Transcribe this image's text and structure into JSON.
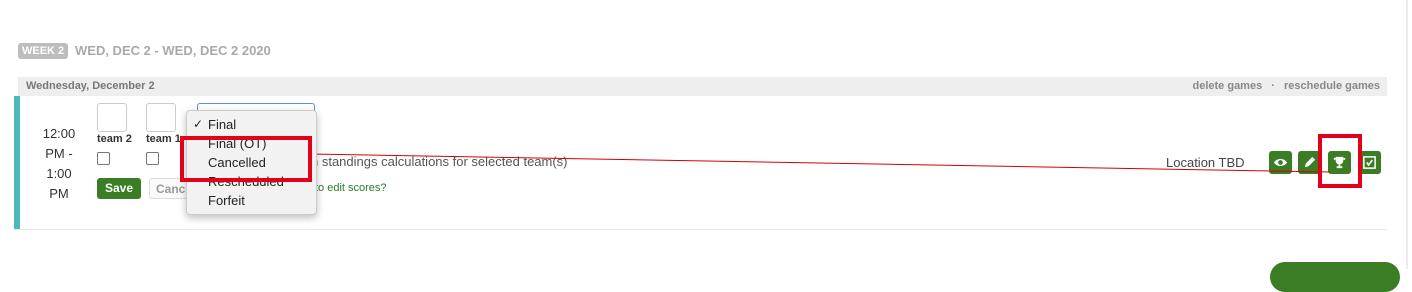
{
  "week": {
    "badge": "WEEK 2",
    "range": "WED, DEC 2 - WED, DEC 2 2020"
  },
  "day": {
    "title": "Wednesday, December 2",
    "actions": [
      "delete games",
      "·",
      "reschedule games"
    ]
  },
  "game": {
    "time_lines": [
      "12:00",
      "PM -",
      "1:00",
      "PM"
    ],
    "teams": [
      {
        "label": "team 2"
      },
      {
        "label": "team 1"
      }
    ],
    "standings_text": "n standings calculations for selected team(s)",
    "edit_link": "to edit scores?",
    "save_label": "Save",
    "cancel_label": "Cancel",
    "location": "Location TBD",
    "status_options": [
      "Final",
      "Final (OT)",
      "Cancelled",
      "Rescheduled",
      "Forfeit"
    ],
    "status_selected": "Final"
  },
  "icons": {
    "view": "eye-icon",
    "edit": "pencil-icon",
    "trophy": "trophy-icon",
    "confirm": "check-square-icon"
  },
  "colors": {
    "accent": "#4bb8bf",
    "button_green": "#3a7d24",
    "highlight_red": "#e3001b"
  }
}
